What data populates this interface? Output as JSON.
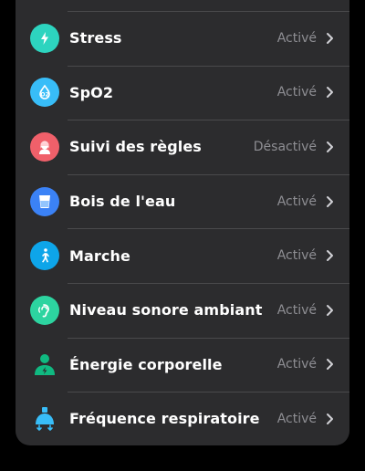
{
  "settings": {
    "items": [
      {
        "label": "Stress",
        "status": "Activé",
        "icon": "lightning-icon",
        "color": "#2dd4bf"
      },
      {
        "label": "SpO2",
        "status": "Activé",
        "icon": "oxygen-drop-icon",
        "color": "#38bdf8"
      },
      {
        "label": "Suivi des règles",
        "status": "Désactivé",
        "icon": "woman-icon",
        "color": "#f0606a"
      },
      {
        "label": "Bois de l'eau",
        "status": "Activé",
        "icon": "water-glass-icon",
        "color": "#3b82f6"
      },
      {
        "label": "Marche",
        "status": "Activé",
        "icon": "walking-icon",
        "color": "#0ea5e9"
      },
      {
        "label": "Niveau sonore ambiant",
        "status": "Activé",
        "icon": "ear-icon",
        "color": "#2dd4a0"
      },
      {
        "label": "Énergie corporelle",
        "status": "Activé",
        "icon": "body-energy-icon",
        "color": "#10b981"
      },
      {
        "label": "Fréquence respiratoire",
        "status": "Activé",
        "icon": "lungs-icon",
        "color": "#38bdf8"
      }
    ]
  }
}
